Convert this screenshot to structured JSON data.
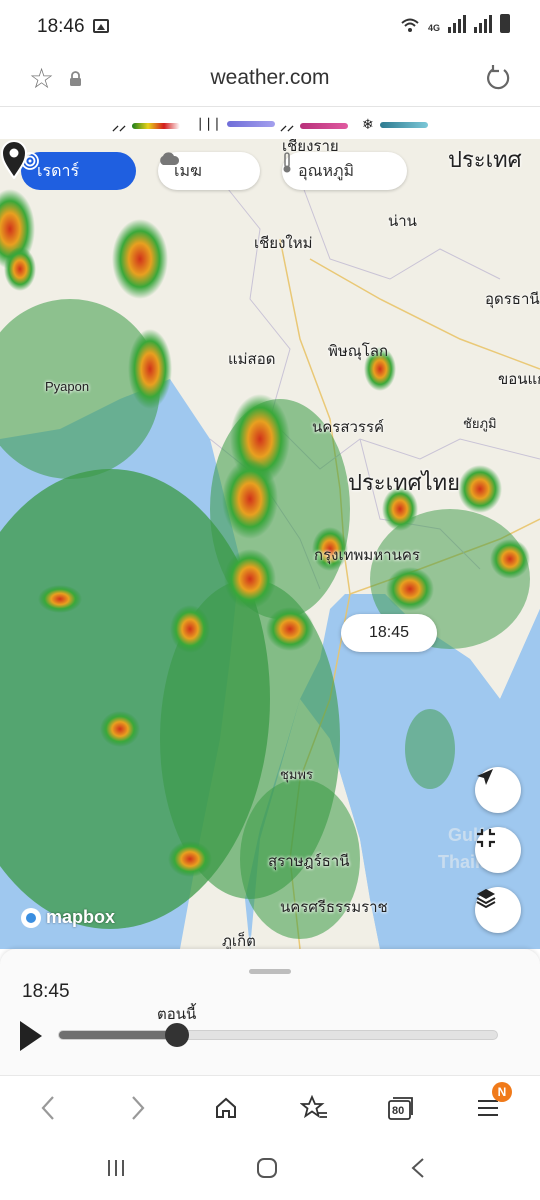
{
  "status_bar": {
    "time": "18:46",
    "network": "4G"
  },
  "address_bar": {
    "url": "weather.com"
  },
  "legend": [
    {
      "icon": "rain-icon",
      "gradient": [
        "#1b7d1b",
        "#e8d21a",
        "#d21c1c",
        "#a81aa8"
      ]
    },
    {
      "icon": "mix-icon",
      "gradient": [
        "#7d7be0",
        "#a0a0f0"
      ]
    },
    {
      "icon": "ice-icon",
      "gradient": [
        "#c8387e",
        "#e05aa0"
      ]
    },
    {
      "icon": "snow-icon",
      "gradient": [
        "#3b8aa0",
        "#7cc8d8"
      ]
    }
  ],
  "map": {
    "chips": {
      "radar": "เรดาร์",
      "clouds": "เมฆ",
      "temperature": "อุณหภูมิ"
    },
    "labels": {
      "chiang_rai": "เชียงราย",
      "chiang_mai": "เชียงใหม่",
      "nan": "น่าน",
      "laos": "ประเทศ",
      "udon": "อุดรธานี",
      "mae_sot": "แม่สอด",
      "phitsanulok": "พิษณุโลก",
      "khon_kaen": "ขอนแก่น",
      "pyapon": "Pyapon",
      "nakhon_sawan": "นครสวรรค์",
      "chaiyaphum": "ชัยภูมิ",
      "thailand": "ประเทศไทย",
      "bangkok": "กรุงเทพมหานคร",
      "chumphon": "ชุมพร",
      "surat": "สุราษฎร์ธานี",
      "nakhon_si": "นครศรีธรรมราช",
      "phuket": "ภูเก็ต",
      "gulf1": "Gulf of",
      "gulf2": "Thailand"
    },
    "pin_time": "18:45",
    "attribution": "mapbox"
  },
  "timeline": {
    "time": "18:45",
    "now_label": "ตอนนี้",
    "progress": 0.27
  },
  "browser_nav": {
    "tabs_count": "80",
    "menu_badge": "N"
  }
}
